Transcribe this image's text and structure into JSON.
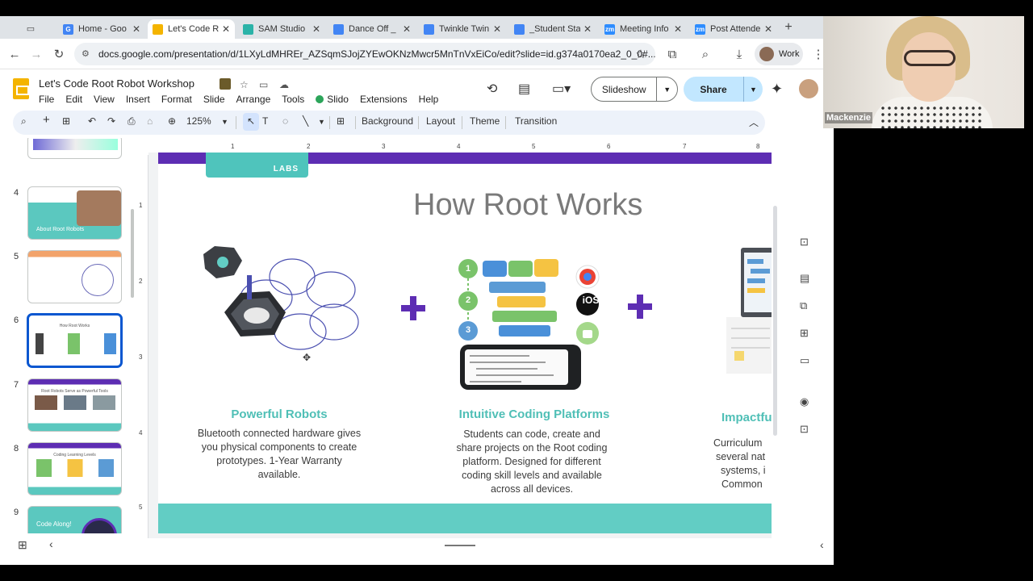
{
  "browser": {
    "tabs": [
      {
        "label": "Home - Goo",
        "color": "#4285f4",
        "fav": "G"
      },
      {
        "label": "Let's Code R",
        "color": "#f4b400",
        "fav": ""
      },
      {
        "label": "SAM Studio",
        "color": "#2bb3a8",
        "fav": ""
      },
      {
        "label": "Dance Off _",
        "color": "#4285f4",
        "fav": ""
      },
      {
        "label": "Twinkle Twin",
        "color": "#4285f4",
        "fav": ""
      },
      {
        "label": "_Student Sta",
        "color": "#4285f4",
        "fav": ""
      },
      {
        "label": "Meeting Info",
        "color": "#2d8cff",
        "fav": "zm"
      },
      {
        "label": "Post Attende",
        "color": "#2d8cff",
        "fav": "zm"
      }
    ],
    "active_tab": 1,
    "url": "docs.google.com/presentation/d/1LXyLdMHREr_AZSqmSJojZYEwOKNzMwcr5MnTnVxEiCo/edit?slide=id.g374a0170ea2_0_0#...",
    "profile_label": "Work"
  },
  "doc": {
    "title": "Let's Code Root Robot Workshop",
    "menu": [
      "File",
      "Edit",
      "View",
      "Insert",
      "Format",
      "Slide",
      "Arrange",
      "Tools",
      "Slido",
      "Extensions",
      "Help"
    ],
    "slideshow_label": "Slideshow",
    "share_label": "Share"
  },
  "toolbar": {
    "zoom": "125%",
    "background": "Background",
    "layout": "Layout",
    "theme": "Theme",
    "transition": "Transition"
  },
  "filmstrip": [
    {
      "num": "4",
      "caption": "About Root Robots"
    },
    {
      "num": "5",
      "caption": ""
    },
    {
      "num": "6",
      "caption": "How Root Works"
    },
    {
      "num": "7",
      "caption": "Root Robots Serve as Powerful Tools"
    },
    {
      "num": "8",
      "caption": "Coding Learning Levels"
    },
    {
      "num": "9",
      "caption": "Code Along!"
    }
  ],
  "ruler": {
    "h": [
      "1",
      "2",
      "3",
      "4",
      "5",
      "6",
      "7",
      "8"
    ],
    "v": [
      "1",
      "2",
      "3",
      "4",
      "5"
    ]
  },
  "slide": {
    "logo_text": "LABS",
    "title": "How Root Works",
    "col1_title": "Powerful Robots",
    "col1_text": "Bluetooth connected hardware gives you physical components to create prototypes. 1-Year Warranty available.",
    "col2_title": "Intuitive Coding Platforms",
    "col2_text": "Students can code, create and share projects on the Root coding platform. Designed for different coding skill levels and available across all devices.",
    "col3_title": "Impactfu",
    "col3_lines": [
      "Curriculum",
      "several nat",
      "systems, i",
      "Common"
    ],
    "steps": [
      "1",
      "2",
      "3"
    ],
    "ios_label": "iOS",
    "accent": "#5d2db3",
    "teal": "#4fbfb6"
  },
  "webcam": {
    "name": "Mackenzie"
  }
}
